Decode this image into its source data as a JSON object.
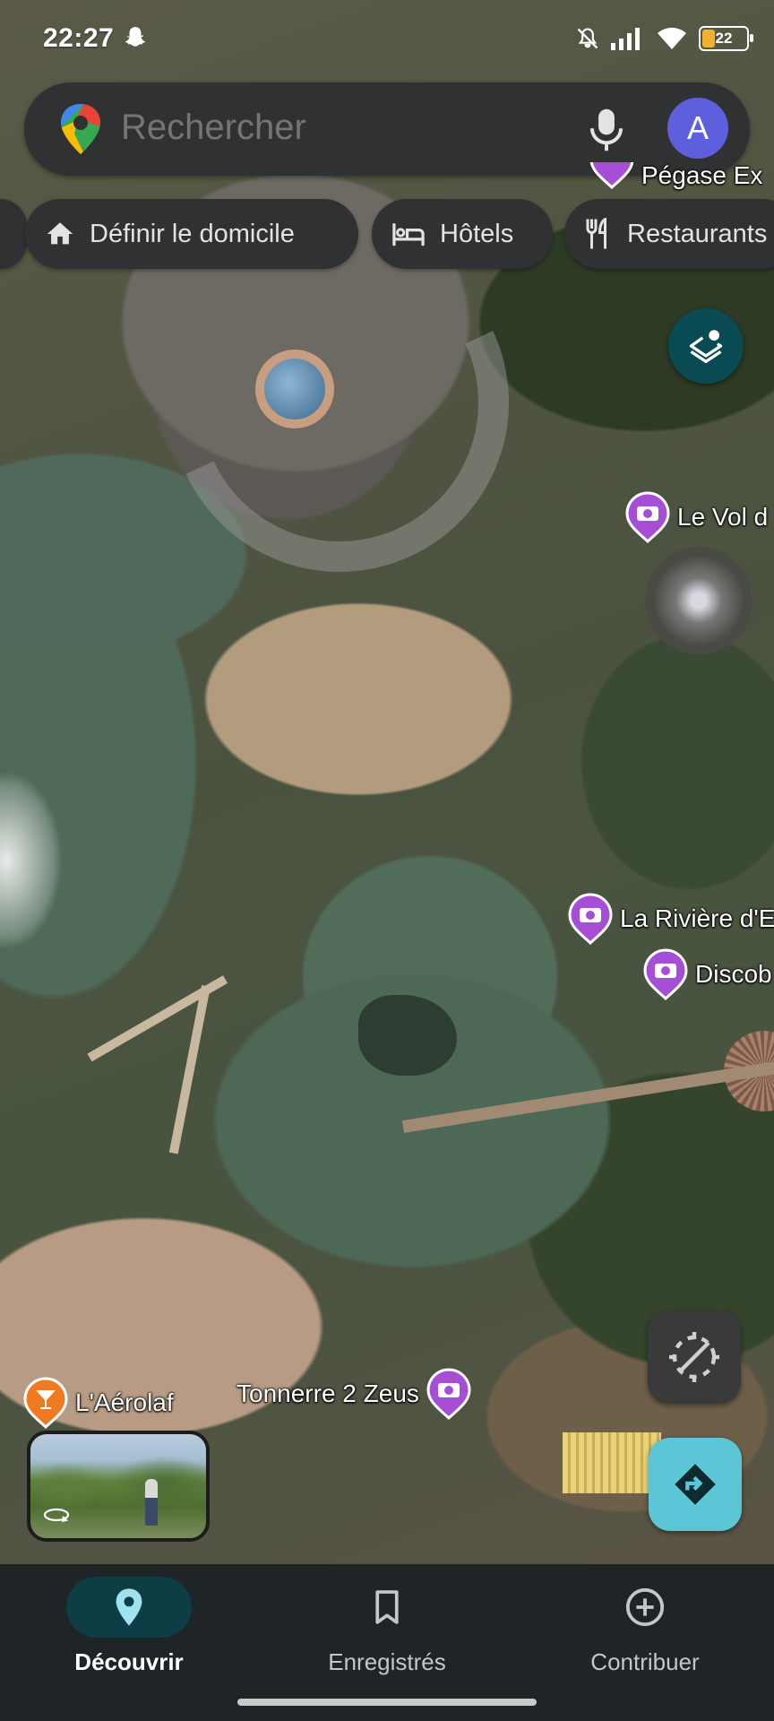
{
  "status_bar": {
    "time": "22:27",
    "battery": "22",
    "icons": [
      "snapchat-icon",
      "mute-icon",
      "signal-icon",
      "wifi-icon",
      "battery-icon"
    ]
  },
  "search": {
    "placeholder": "Rechercher",
    "avatar_letter": "A",
    "avatar_color": "#5d5fdc"
  },
  "chips": {
    "home": "Définir le domicile",
    "hotels": "Hôtels",
    "restaurants": "Restaurants"
  },
  "map": {
    "pois": [
      {
        "label": "Pégase Ex",
        "icon": "camera-icon"
      },
      {
        "label": "Le Vol d",
        "icon": "camera-icon"
      },
      {
        "label": "La Rivière d'E",
        "icon": "camera-icon"
      },
      {
        "label": "Discob",
        "icon": "camera-icon"
      },
      {
        "label": "Tonnerre 2 Zeus",
        "icon": "camera-icon"
      },
      {
        "label": "L'Aérolaf",
        "icon": "cocktail-icon"
      }
    ],
    "accent_poi_color": "#a64fd6",
    "bar_poi_color": "#f07a22"
  },
  "nav": {
    "items": [
      {
        "label": "Découvrir",
        "icon": "pin-icon",
        "active": true
      },
      {
        "label": "Enregistrés",
        "icon": "bookmark-icon",
        "active": false
      },
      {
        "label": "Contribuer",
        "icon": "add-circle-icon",
        "active": false
      }
    ]
  }
}
